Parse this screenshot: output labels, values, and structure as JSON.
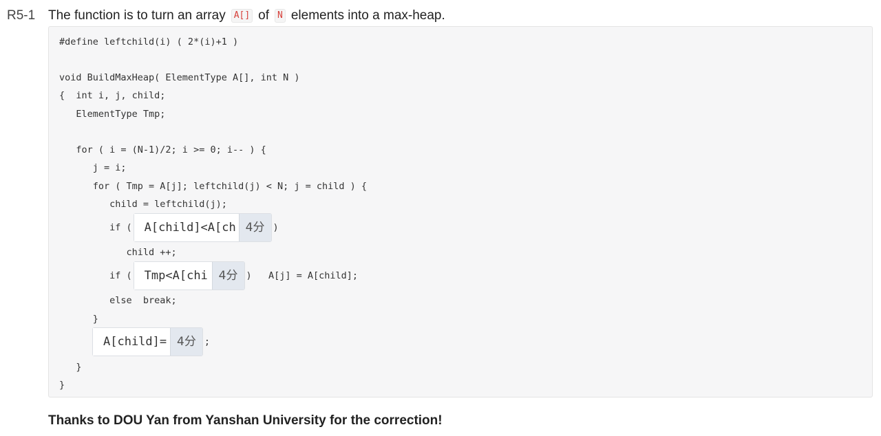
{
  "question": {
    "number": "R5-1",
    "prompt_before": "The function is to turn an array",
    "code_array": "A[]",
    "prompt_mid": "of",
    "code_n": "N",
    "prompt_after": "elements into a max-heap."
  },
  "code": {
    "line1": "#define leftchild(i) ( 2*(i)+1 )",
    "line2": "void BuildMaxHeap( ElementType A[], int N )",
    "line3": "{  int i, j, child;",
    "line4": "   ElementType Tmp;",
    "line5": "   for ( i = (N-1)/2; i >= 0; i-- ) {",
    "line6": "      j = i;",
    "line7": "      for ( Tmp = A[j]; leftchild(j) < N; j = child ) {",
    "line8": "         child = leftchild(j);",
    "line9_prefix": "         if (",
    "line9_suffix": ")",
    "line10": "            child ++;",
    "line11_prefix": "         if (",
    "line11_suffix": ")   A[j] = A[child];",
    "line12": "         else  break;",
    "line13": "      }",
    "line14_suffix": ";",
    "line15": "   }",
    "line16": "}"
  },
  "blanks": [
    {
      "value": "A[child]<A[ch",
      "score": "4分"
    },
    {
      "value": "Tmp<A[chi",
      "score": "4分"
    },
    {
      "value": "A[child]=",
      "score": "4分"
    }
  ],
  "footer": {
    "thanks": "Thanks to DOU Yan from Yanshan University for the correction!"
  }
}
